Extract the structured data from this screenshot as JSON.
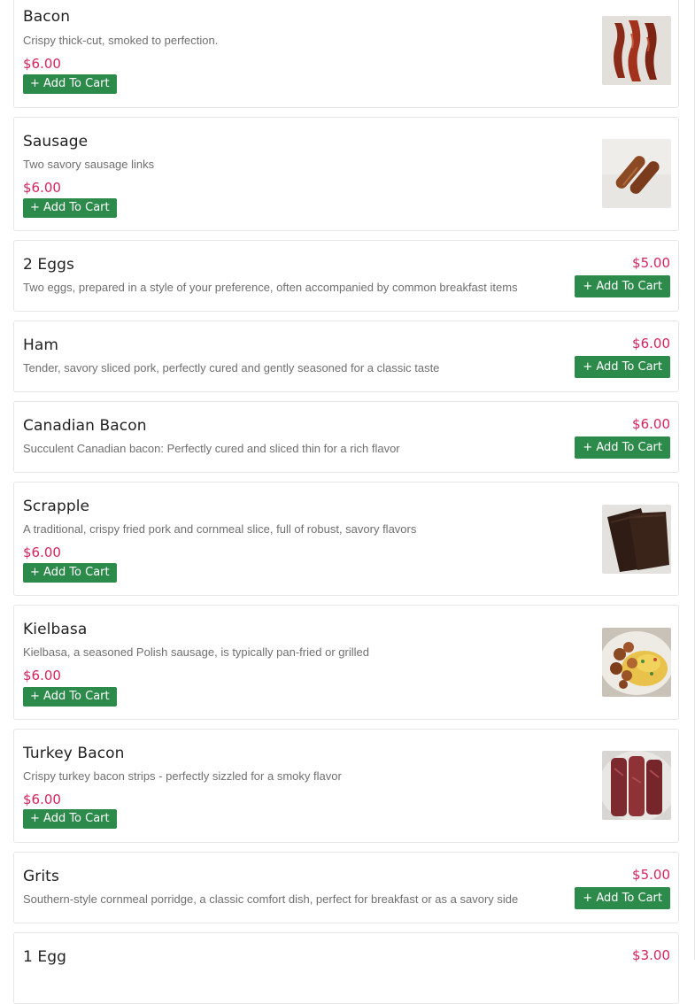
{
  "currency_color": "#d6245c",
  "button_color": "#2c8a4b",
  "items": [
    {
      "name": "Bacon",
      "description": "Crispy thick-cut, smoked to perfection.",
      "price": "$6.00",
      "button": "+ Add To Cart",
      "image": "bacon-photo"
    },
    {
      "name": "Sausage",
      "description": "Two savory sausage links",
      "price": "$6.00",
      "button": "+ Add To Cart",
      "image": "sausage-photo"
    },
    {
      "name": "2 Eggs",
      "description": "Two eggs, prepared in a style of your preference, often accompanied by common breakfast items",
      "price": "$5.00",
      "button": "+ Add To Cart"
    },
    {
      "name": "Ham",
      "description": "Tender, savory sliced pork, perfectly cured and gently seasoned for a classic taste",
      "price": "$6.00",
      "button": "+ Add To Cart"
    },
    {
      "name": "Canadian Bacon",
      "description": "Succulent Canadian bacon: Perfectly cured and sliced thin for a rich flavor",
      "price": "$6.00",
      "button": "+ Add To Cart"
    },
    {
      "name": "Scrapple",
      "description": "A traditional, crispy fried pork and cornmeal slice, full of robust, savory flavors",
      "price": "$6.00",
      "button": "+ Add To Cart",
      "image": "scrapple-photo"
    },
    {
      "name": "Kielbasa",
      "description": "Kielbasa, a seasoned Polish sausage, is typically pan-fried or grilled",
      "price": "$6.00",
      "button": "+ Add To Cart",
      "image": "kielbasa-photo"
    },
    {
      "name": "Turkey Bacon",
      "description": "Crispy turkey bacon strips - perfectly sizzled for a smoky flavor",
      "price": "$6.00",
      "button": "+ Add To Cart",
      "image": "turkey-bacon-photo"
    },
    {
      "name": "Grits",
      "description": "Southern-style cornmeal porridge, a classic comfort dish, perfect for breakfast or as a savory side",
      "price": "$5.00",
      "button": "+ Add To Cart"
    },
    {
      "name": "1 Egg",
      "price": "$3.00"
    }
  ]
}
